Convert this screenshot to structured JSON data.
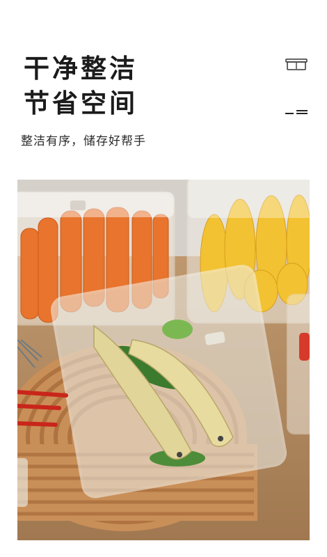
{
  "headline": {
    "line1": "干净整洁",
    "line2": "节省空间"
  },
  "subheadline": "整洁有序，储存好帮手",
  "icons": {
    "top_right": "storage-box-icon",
    "mid_right": "lines-icon"
  },
  "photo": {
    "subject": "food-storage-containers-photo"
  },
  "colors": {
    "text": "#1b1b1b",
    "background": "#ffffff"
  }
}
